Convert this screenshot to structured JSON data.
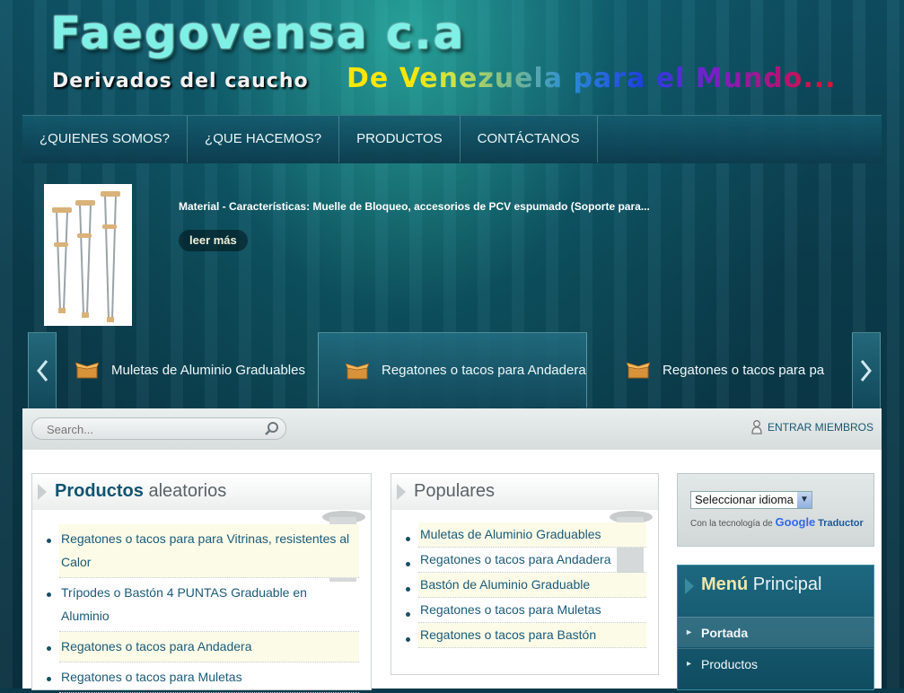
{
  "header": {
    "site_title": "Faegovensa c.a",
    "tagline": "Derivados del caucho",
    "slogan": "De Venezuela para el Mundo..."
  },
  "nav": {
    "items": [
      "¿QUIENES SOMOS?",
      "¿QUE HACEMOS?",
      "PRODUCTOS",
      "CONTÁCTANOS"
    ]
  },
  "featured": {
    "text": "Material - Características: Muelle de Bloqueo, accesorios de PCV espumado (Soporte para...",
    "read_more": "leer más"
  },
  "slider": {
    "items": [
      "Muletas de Aluminio Graduables",
      "Regatones o tacos para Andadera",
      "Regatones o tacos para pa"
    ]
  },
  "toolbar": {
    "search_placeholder": "Search...",
    "members_label": "ENTRAR MIEMBROS"
  },
  "random_products": {
    "title_bold": "Productos",
    "title_rest": "aleatorios",
    "items": [
      "Regatones o tacos para para Vitrinas, resistentes al Calor",
      "Trípodes o Bastón 4 PUNTAS Graduable en Aluminio",
      "Regatones o tacos para Andadera",
      "Regatones o tacos para Muletas"
    ]
  },
  "popular": {
    "title": "Populares",
    "items": [
      "Muletas de Aluminio Graduables",
      "Regatones o tacos para Andadera",
      "Bastón de Aluminio Graduable",
      "Regatones o tacos para Muletas",
      "Regatones o tacos para Bastón"
    ]
  },
  "translate": {
    "select_label": "Seleccionar idioma",
    "powered_by": "Con la tecnología de",
    "google": "Google",
    "translator": "Traductor"
  },
  "main_menu": {
    "title_bold": "Menú",
    "title_rest": "Principal",
    "items": [
      "Portada",
      "Productos"
    ]
  },
  "colors": {
    "accent": "#0f5470",
    "header_bg": "#0e4f63",
    "link": "#1a5a78"
  }
}
